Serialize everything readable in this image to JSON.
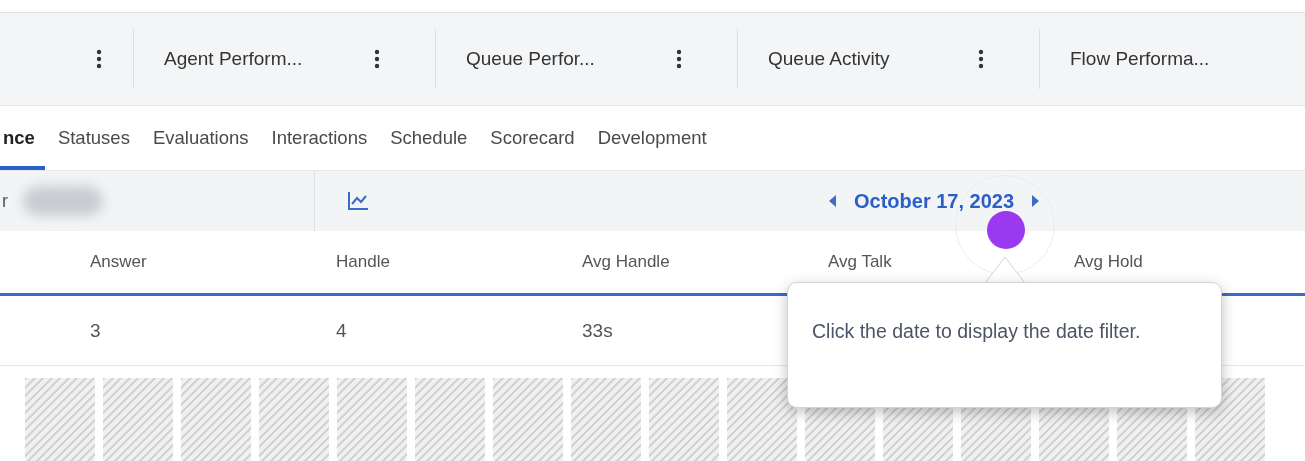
{
  "toolbar": {
    "tabs": [
      {
        "label": "Agent Perform..."
      },
      {
        "label": "Queue Perfor..."
      },
      {
        "label": "Queue Activity"
      },
      {
        "label": "Flow Performa..."
      }
    ]
  },
  "tabs": [
    {
      "label": "nce",
      "selected": true
    },
    {
      "label": "Statuses",
      "selected": false
    },
    {
      "label": "Evaluations",
      "selected": false
    },
    {
      "label": "Interactions",
      "selected": false
    },
    {
      "label": "Schedule",
      "selected": false
    },
    {
      "label": "Scorecard",
      "selected": false
    },
    {
      "label": "Development",
      "selected": false
    }
  ],
  "filter_bar": {
    "cut_label": "r",
    "date": "October 17, 2023"
  },
  "table": {
    "columns": [
      "Answer",
      "Handle",
      "Avg Handle",
      "Avg Talk",
      "Avg Hold"
    ],
    "rows": [
      [
        "3",
        "4",
        "33s"
      ]
    ]
  },
  "tooltip": {
    "text": "Click the date to display the date filter."
  }
}
